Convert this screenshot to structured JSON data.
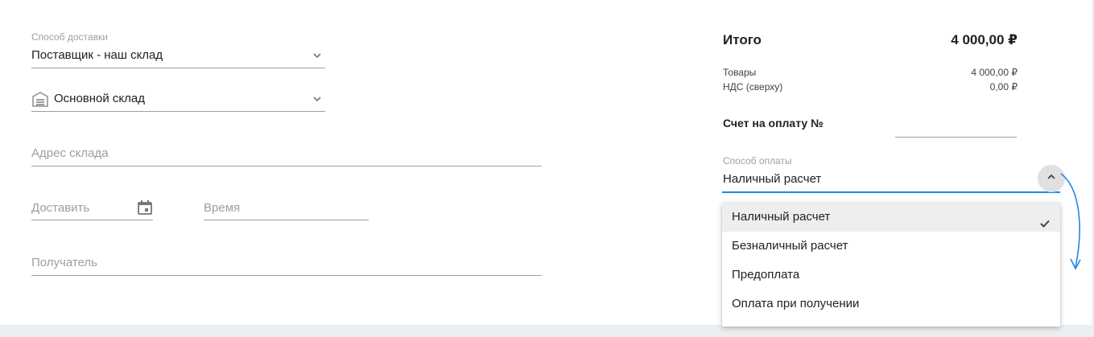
{
  "delivery": {
    "method_label": "Способ доставки",
    "method_value": "Поставщик - наш склад",
    "warehouse_value": "Основной склад",
    "address_placeholder": "Адрес склада",
    "deliver_placeholder": "Доставить",
    "time_placeholder": "Время",
    "recipient_placeholder": "Получатель"
  },
  "summary": {
    "title": "Итого",
    "total": "4 000,00 ₽",
    "goods_label": "Товары",
    "goods_value": "4 000,00 ₽",
    "vat_label": "НДС (сверху)",
    "vat_value": "0,00 ₽",
    "invoice_label": "Счет на оплату №",
    "invoice_value": ""
  },
  "payment": {
    "label": "Способ оплаты",
    "value": "Наличный расчет",
    "options": [
      {
        "label": "Наличный расчет",
        "selected": true
      },
      {
        "label": "Безналичный расчет",
        "selected": false
      },
      {
        "label": "Предоплата",
        "selected": false
      },
      {
        "label": "Оплата при получении",
        "selected": false
      }
    ]
  },
  "colors": {
    "accent": "#1e88e5",
    "selected_bg": "#eeeeee",
    "muted_text": "#9e9e9e"
  },
  "icons": {
    "warehouse": "warehouse-icon",
    "calendar": "calendar-icon",
    "chevron": "chevron-down-icon",
    "toggle": "chevron-up-icon",
    "check": "check-icon"
  }
}
